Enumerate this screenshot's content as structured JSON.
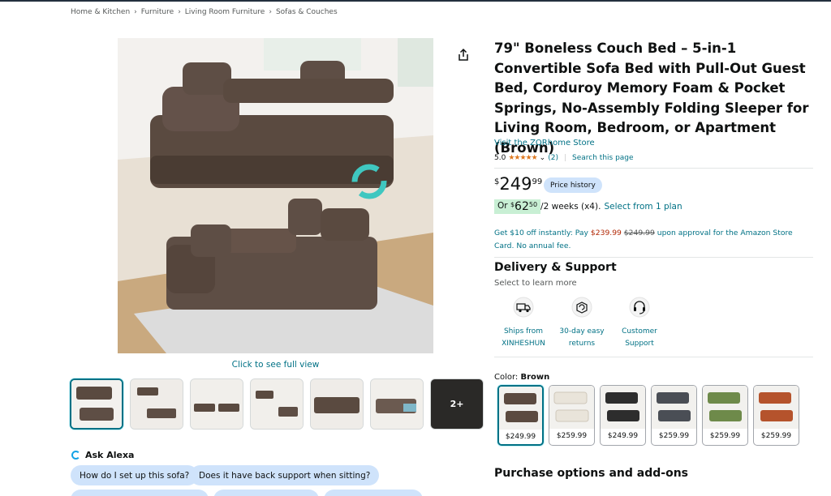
{
  "breadcrumb": [
    "Home & Kitchen",
    "Furniture",
    "Living Room Furniture",
    "Sofas & Couches"
  ],
  "breadcrumb_sep": "›",
  "gallery": {
    "see_full": "Click to see full view",
    "more_label": "2+"
  },
  "alexa": {
    "title": "Ask Alexa",
    "questions": [
      "How do I set up this sofa?",
      "Does it have back support when sitting?"
    ]
  },
  "product": {
    "title": "79\" Boneless Couch Bed – 5-in-1 Convertible Sofa Bed with Pull-Out Guest Bed, Corduroy Memory Foam & Pocket Springs, No-Assembly Folding Sleeper for Living Room, Bedroom, or Apartment (Brown)",
    "store": "Visit the ZQRhome Store",
    "rating": "5.0",
    "stars": "★★★★★",
    "rating_count": "(2)",
    "search_page": "Search this page"
  },
  "price": {
    "currency": "$",
    "whole": "249",
    "fraction": "99",
    "history_label": "Price history",
    "inst_prefix": "Or",
    "inst_currency": "$",
    "inst_whole": "62",
    "inst_fraction": "50",
    "inst_terms": "/2 weeks (x4).",
    "inst_plan": "Select from 1 plan",
    "card_text_a": "Get $10 off instantly: Pay",
    "card_price_new": "$239.99",
    "card_price_old": "$249.99",
    "card_text_b": "upon approval for the Amazon Store Card. No annual fee."
  },
  "delivery": {
    "heading": "Delivery & Support",
    "sub": "Select to learn more",
    "features": [
      {
        "line1": "Ships from",
        "line2": "XINHESHUN",
        "icon": "truck-icon"
      },
      {
        "line1": "30-day easy",
        "line2": "returns",
        "icon": "return-box-icon"
      },
      {
        "line1": "Customer",
        "line2": "Support",
        "icon": "headset-icon"
      }
    ]
  },
  "color": {
    "label": "Color:",
    "selected": "Brown",
    "swatches": [
      {
        "price": "$249.99",
        "color": "#5b4a40"
      },
      {
        "price": "$259.99",
        "color": "#e9e4da"
      },
      {
        "price": "$249.99",
        "color": "#2d2d2d"
      },
      {
        "price": "$259.99",
        "color": "#4a4e55"
      },
      {
        "price": "$259.99",
        "color": "#6e8a4a"
      },
      {
        "price": "$259.99",
        "color": "#b5532c"
      }
    ]
  },
  "purchase_heading": "Purchase options and add-ons",
  "colors": {
    "link": "#007185",
    "price_red": "#b12704",
    "star": "#de7921",
    "chip_bg": "#cfe3fb",
    "inst_bg": "#c8efd4"
  }
}
